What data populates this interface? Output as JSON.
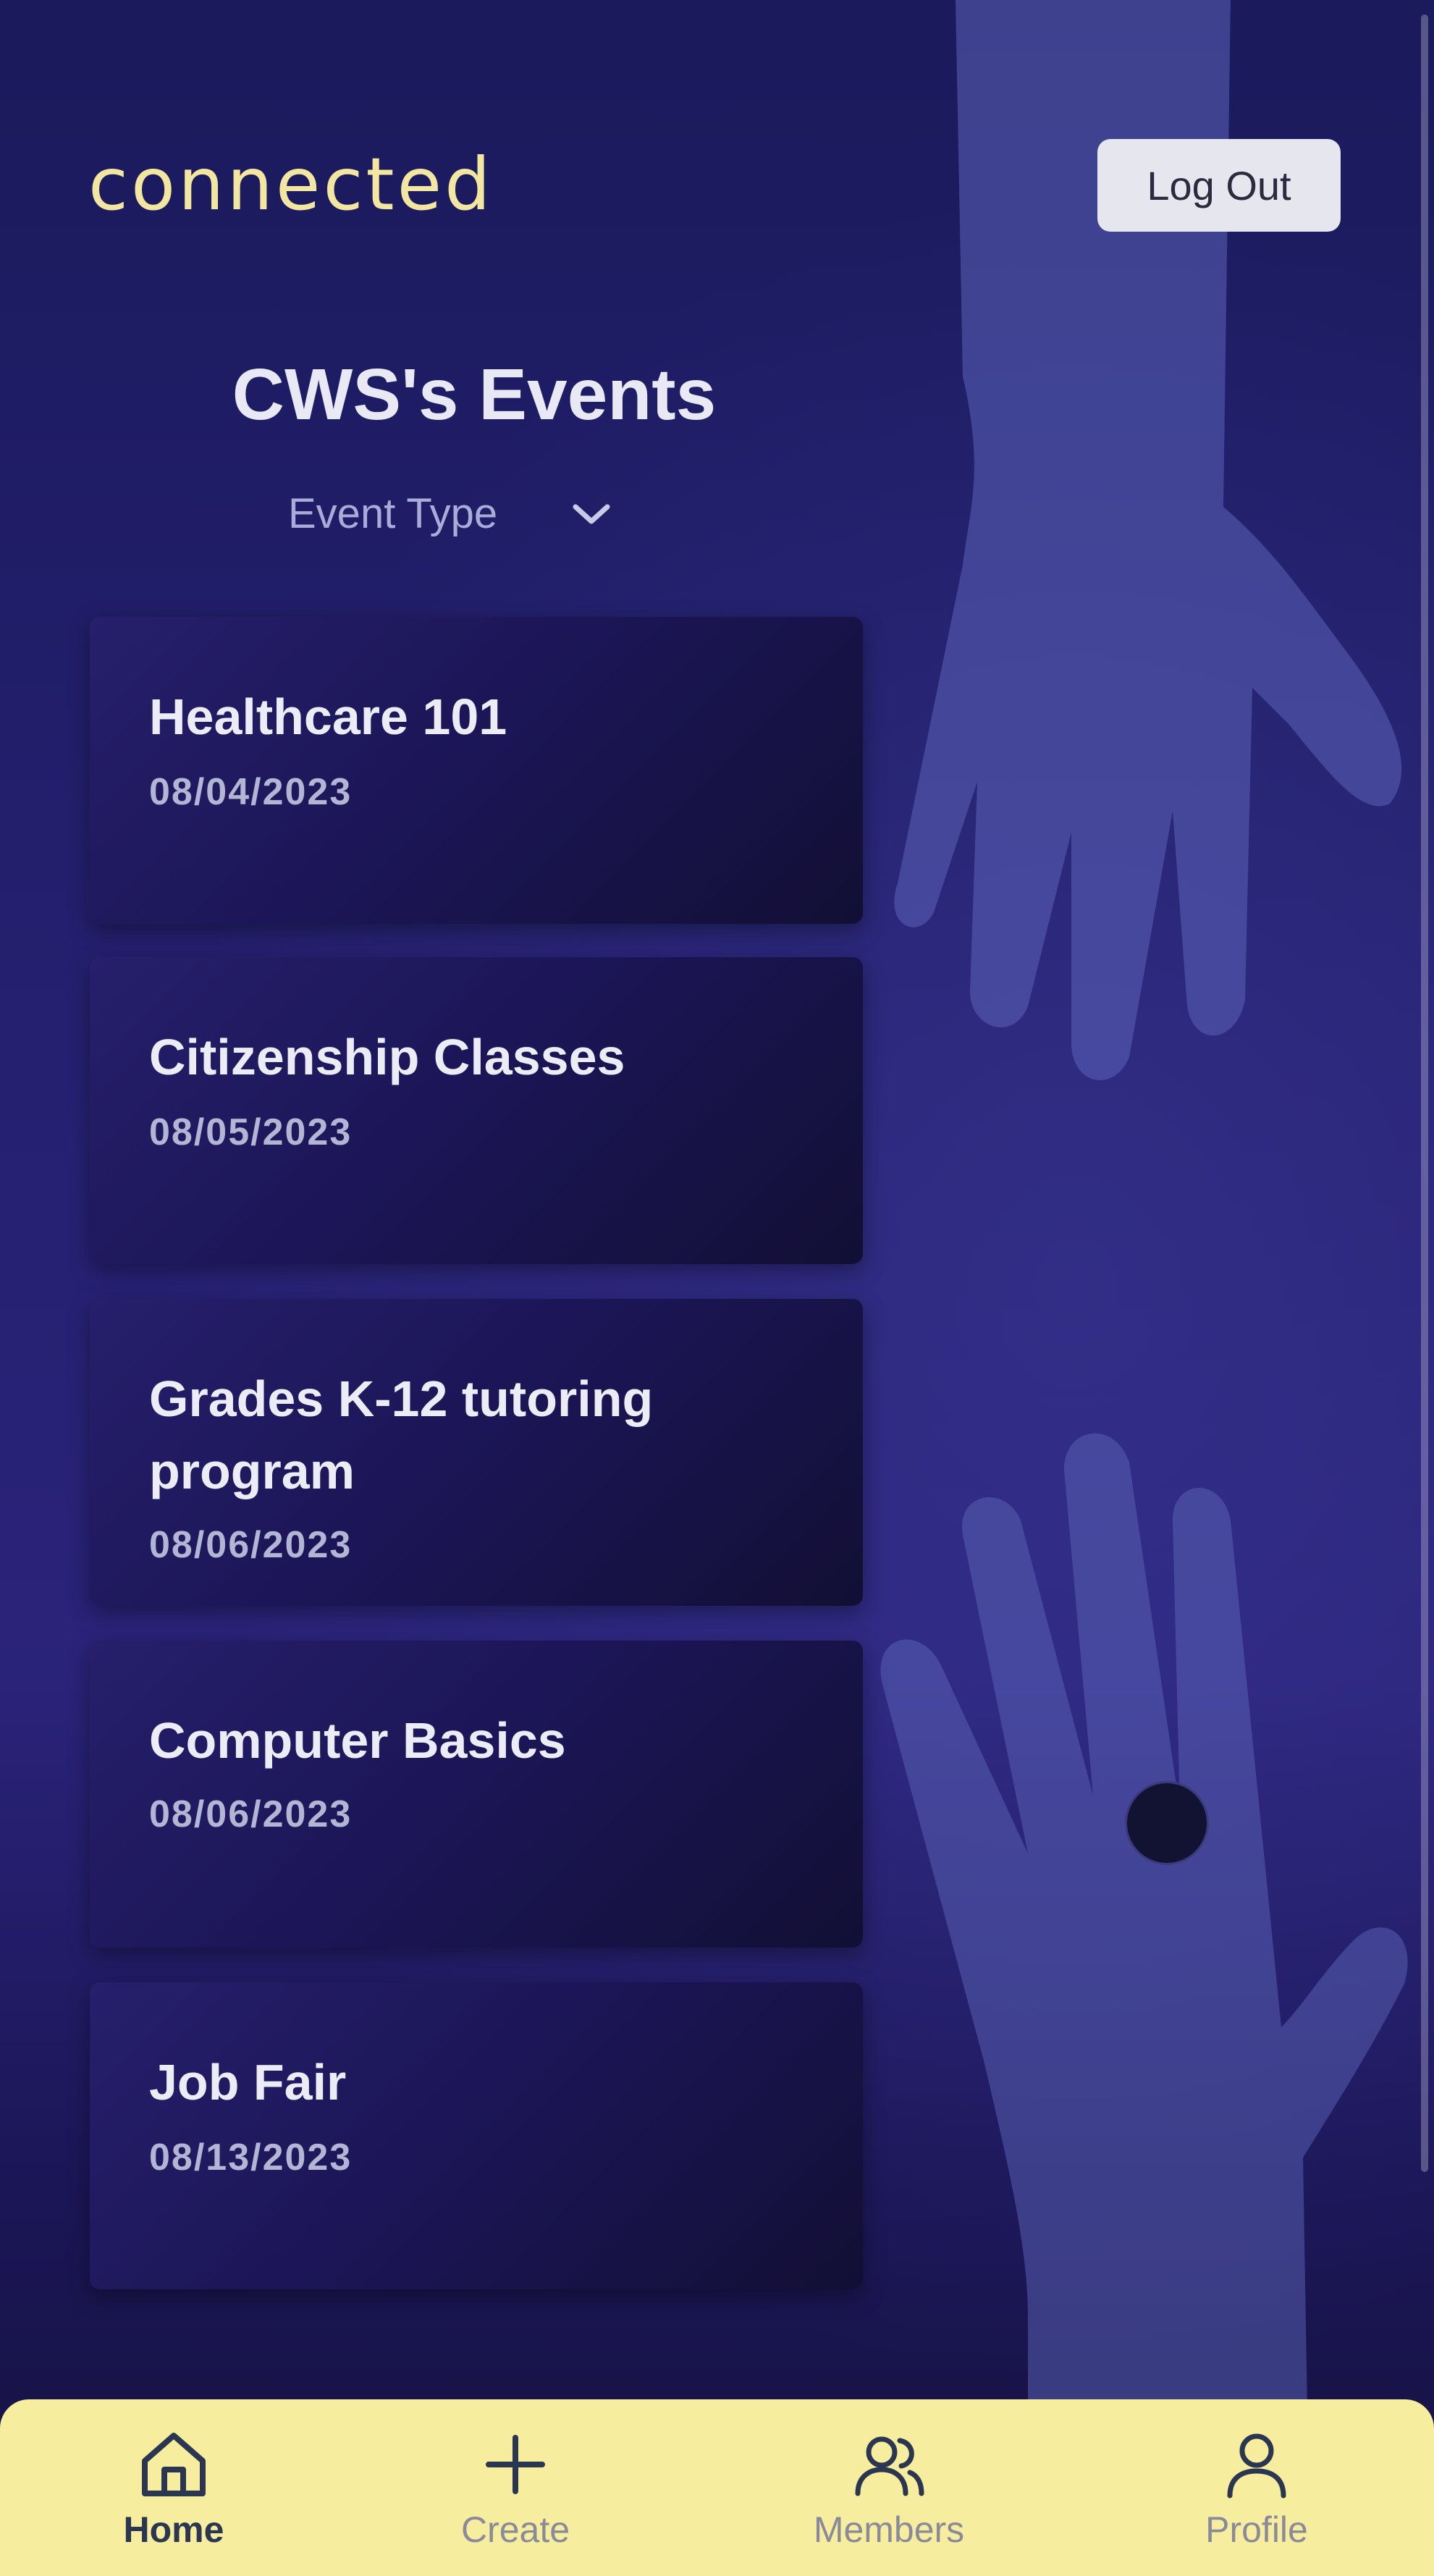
{
  "app": {
    "logo_text": "connected",
    "logout_label": "Log Out"
  },
  "header": {
    "title": "CWS's Events",
    "filter_label": "Event Type"
  },
  "events": [
    {
      "title": "Healthcare 101",
      "date": "08/04/2023"
    },
    {
      "title": "Citizenship Classes",
      "date": "08/05/2023"
    },
    {
      "title": "Grades K-12 tutoring program",
      "date": "08/06/2023"
    },
    {
      "title": "Computer Basics",
      "date": "08/06/2023"
    },
    {
      "title": "Job Fair",
      "date": "08/13/2023"
    }
  ],
  "nav": {
    "items": [
      {
        "label": "Home",
        "icon": "home-icon",
        "active": true
      },
      {
        "label": "Create",
        "icon": "plus-icon",
        "active": false
      },
      {
        "label": "Members",
        "icon": "members-icon",
        "active": false
      },
      {
        "label": "Profile",
        "icon": "profile-icon",
        "active": false
      }
    ]
  },
  "colors": {
    "background": "#231e6e",
    "logo": "#f2e6a0",
    "nav_background": "#f6ed9f",
    "card": "#1c1658",
    "active_nav": "#2b3650",
    "inactive_nav": "#8a8a9a"
  }
}
